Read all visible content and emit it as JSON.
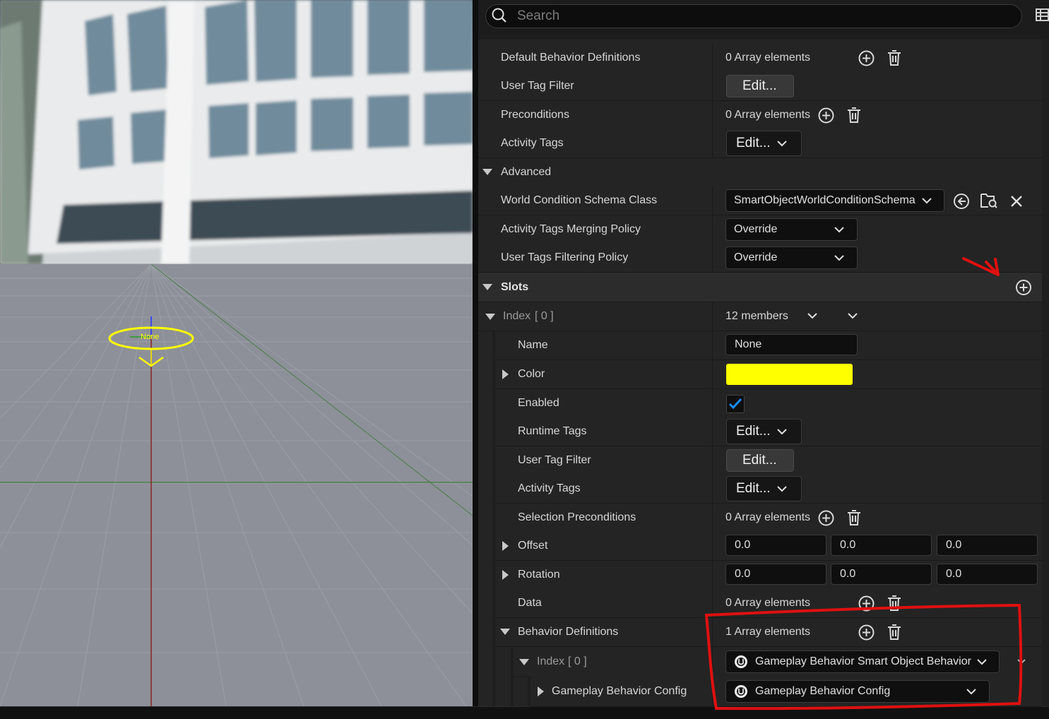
{
  "viewport": {
    "actor_label": "None",
    "colors": {
      "gizmo": "#ffff00",
      "floor": "#8d9098"
    }
  },
  "search": {
    "placeholder": "Search"
  },
  "rows": {
    "default_behavior_definitions": {
      "label": "Default Behavior Definitions",
      "value": "0 Array elements"
    },
    "user_tag_filter": {
      "label": "User Tag Filter",
      "button": "Edit..."
    },
    "preconditions": {
      "label": "Preconditions",
      "value": "0 Array elements"
    },
    "activity_tags": {
      "label": "Activity Tags",
      "button": "Edit..."
    },
    "advanced": {
      "label": "Advanced"
    },
    "world_condition_schema_class": {
      "label": "World Condition Schema Class",
      "value": "SmartObjectWorldConditionSchema"
    },
    "activity_tags_merging_policy": {
      "label": "Activity Tags Merging Policy",
      "value": "Override"
    },
    "user_tags_filtering_policy": {
      "label": "User Tags Filtering Policy",
      "value": "Override"
    },
    "slots": {
      "label": "Slots"
    },
    "slot_index": {
      "label": "Index",
      "index": "[ 0 ]",
      "value": "12 members"
    },
    "name": {
      "label": "Name",
      "value": "None"
    },
    "color": {
      "label": "Color",
      "value": "#ffff00"
    },
    "enabled": {
      "label": "Enabled",
      "checked": true
    },
    "runtime_tags": {
      "label": "Runtime Tags",
      "button": "Edit..."
    },
    "slot_user_tag_filter": {
      "label": "User Tag Filter",
      "button": "Edit..."
    },
    "slot_activity_tags": {
      "label": "Activity Tags",
      "button": "Edit..."
    },
    "selection_preconditions": {
      "label": "Selection Preconditions",
      "value": "0 Array elements"
    },
    "offset": {
      "label": "Offset",
      "x": "0.0",
      "y": "0.0",
      "z": "0.0"
    },
    "rotation": {
      "label": "Rotation",
      "x": "0.0",
      "y": "0.0",
      "z": "0.0"
    },
    "data": {
      "label": "Data",
      "value": "0 Array elements"
    },
    "behavior_definitions": {
      "label": "Behavior Definitions",
      "value": "1 Array elements"
    },
    "behavior_index": {
      "label": "Index",
      "index": "[ 0 ]",
      "value": "Gameplay Behavior Smart Object Behavior"
    },
    "gameplay_behavior_config": {
      "label": "Gameplay Behavior Config",
      "value": "Gameplay Behavior Config"
    }
  },
  "annotation_color": "#e01010",
  "accent_checkbox": "#1a8cff"
}
